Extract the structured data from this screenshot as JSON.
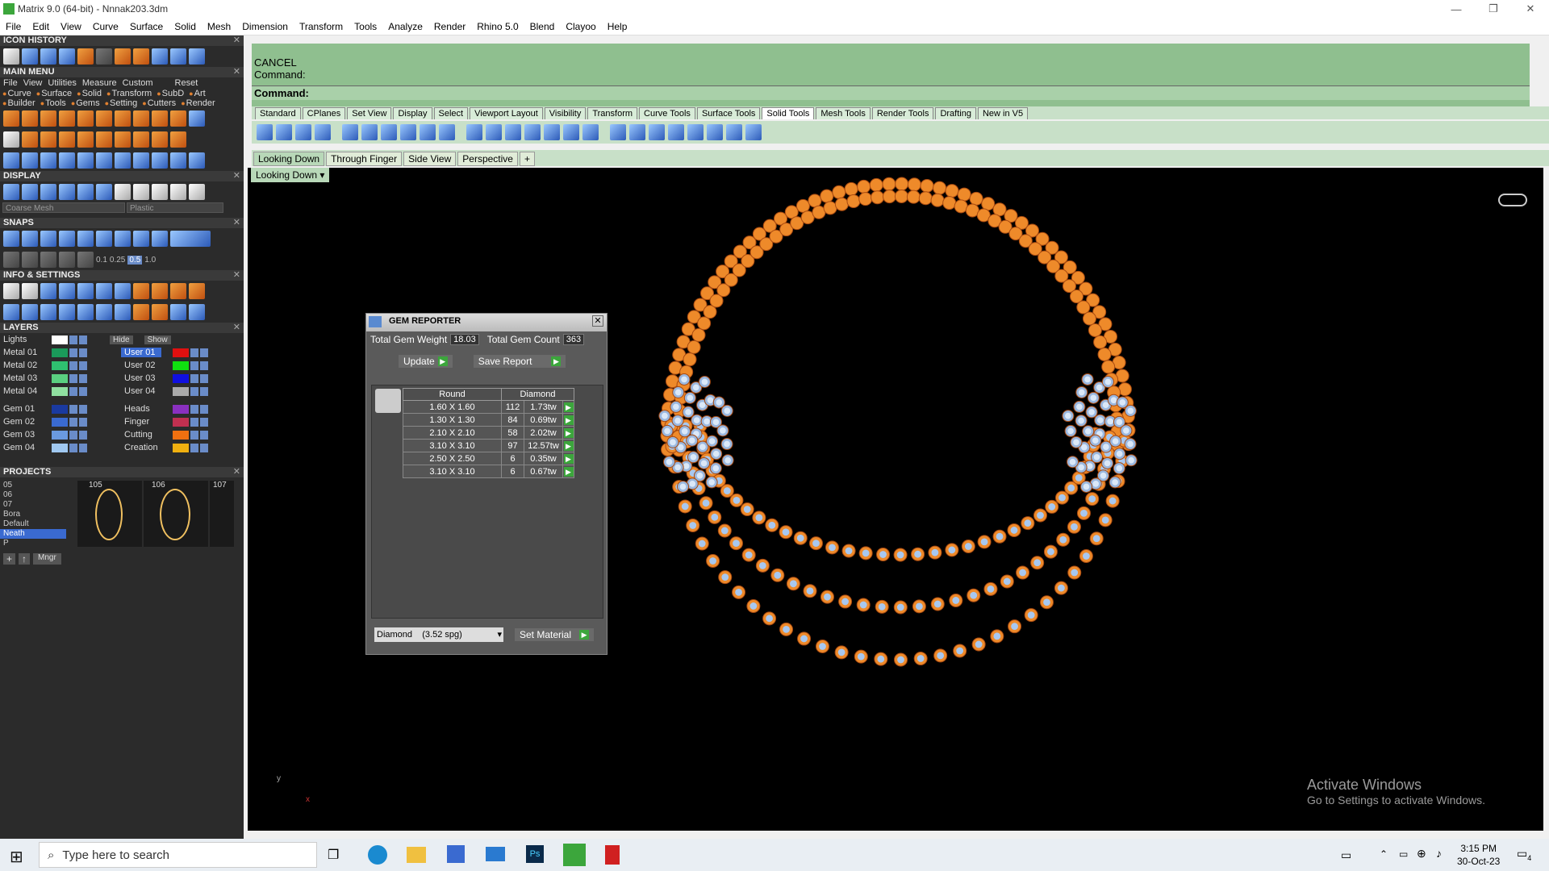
{
  "window": {
    "title": "Matrix 9.0 (64-bit) - Nnnak203.3dm"
  },
  "menu": [
    "File",
    "Edit",
    "View",
    "Curve",
    "Surface",
    "Solid",
    "Mesh",
    "Dimension",
    "Transform",
    "Tools",
    "Analyze",
    "Render",
    "Rhino 5.0",
    "Blend",
    "Clayoo",
    "Help"
  ],
  "left": {
    "icon_history": "ICON HISTORY",
    "main_menu": "MAIN MENU",
    "main_menu_items": [
      "File",
      "View",
      "Utilities",
      "Measure",
      "Custom",
      "Reset"
    ],
    "bullets1": [
      "Curve",
      "Surface",
      "Solid",
      "Transform",
      "SubD",
      "Art"
    ],
    "bullets2": [
      "Builder",
      "Tools",
      "Gems",
      "Setting",
      "Cutters",
      "Render"
    ],
    "display": "DISPLAY",
    "display_mesh": "Coarse Mesh",
    "display_mat": "Plastic",
    "snaps": "SNAPS",
    "snap_vals": [
      "0.1",
      "0.25",
      "0.5",
      "1.0"
    ],
    "info": "INFO & SETTINGS",
    "layers": "LAYERS",
    "lights": "Lights",
    "hide": "Hide",
    "show": "Show",
    "layer_left": [
      "Metal 01",
      "Metal 02",
      "Metal 03",
      "Metal 04",
      "Gem 01",
      "Gem 02",
      "Gem 03",
      "Gem 04"
    ],
    "layer_right": [
      "User 01",
      "User 02",
      "User 03",
      "User 04",
      "Heads",
      "Finger",
      "Cutting",
      "Creation"
    ],
    "projects": "PROJECTS",
    "project_list": [
      "05",
      "06",
      "07",
      "Bora",
      "Default",
      "Neath",
      "P"
    ],
    "project_nums": [
      "105",
      "106",
      "107"
    ],
    "mngr": "Mngr"
  },
  "command": {
    "cancel": "CANCEL",
    "prompt1": "Command:",
    "prompt2": "Command:"
  },
  "toolbar_tabs": [
    "Standard",
    "CPlanes",
    "Set View",
    "Display",
    "Select",
    "Viewport Layout",
    "Visibility",
    "Transform",
    "Curve Tools",
    "Surface Tools",
    "Solid Tools",
    "Mesh Tools",
    "Render Tools",
    "Drafting",
    "New in V5"
  ],
  "view_tabs": [
    "Looking Down",
    "Through Finger",
    "Side View",
    "Perspective",
    "+"
  ],
  "viewport": {
    "label": "Looking Down",
    "watermark1": "Activate Windows",
    "watermark2": "Go to Settings to activate Windows.",
    "axis_y": "y",
    "axis_x": "x"
  },
  "gem": {
    "title": "GEM REPORTER",
    "weight_label": "Total Gem Weight",
    "weight": "18.03",
    "count_label": "Total Gem Count",
    "count": "363",
    "update": "Update",
    "save": "Save Report",
    "col_shape": "Round",
    "col_type": "Diamond",
    "rows": [
      {
        "size": "1.60 X 1.60",
        "qty": "112",
        "wt": "1.73tw"
      },
      {
        "size": "1.30 X 1.30",
        "qty": "84",
        "wt": "0.69tw"
      },
      {
        "size": "2.10 X 2.10",
        "qty": "58",
        "wt": "2.02tw"
      },
      {
        "size": "3.10 X 3.10",
        "qty": "97",
        "wt": "12.57tw"
      },
      {
        "size": "2.50 X 2.50",
        "qty": "6",
        "wt": "0.35tw"
      },
      {
        "size": "3.10 X 3.10",
        "qty": "6",
        "wt": "0.67tw"
      }
    ],
    "material": "Diamond    (3.52 spg)",
    "set_material": "Set Material"
  },
  "taskbar": {
    "search": "Type here to search",
    "time": "3:15 PM",
    "date": "30-Oct-23",
    "notif": "4"
  },
  "colors": {
    "cmd_green": "#8fbf8f",
    "gold": "#ee8a2a",
    "gem_blue": "#a8c8f0"
  }
}
